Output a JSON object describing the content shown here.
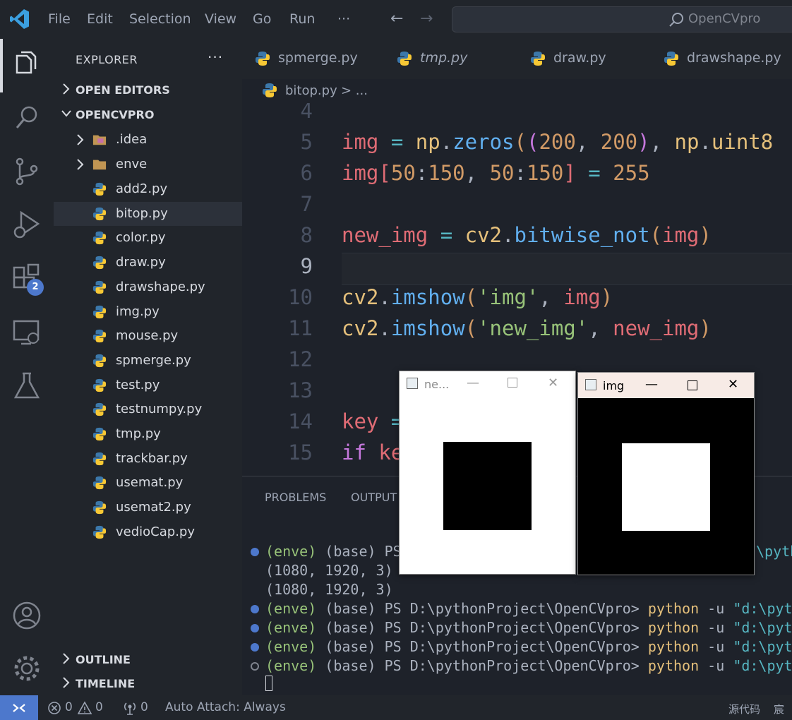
{
  "titlebar": {
    "menu": [
      "File",
      "Edit",
      "Selection",
      "View",
      "Go",
      "Run",
      "···"
    ],
    "search_text": "OpenCVpro"
  },
  "activity_bar": {
    "items": [
      "explorer-icon",
      "search-icon",
      "source-control-icon",
      "run-debug-icon",
      "extensions-icon",
      "remote-explorer-icon",
      "testing-icon"
    ],
    "extensions_badge": "2",
    "bottom": [
      "account-icon",
      "settings-gear-icon"
    ]
  },
  "sidebar": {
    "title": "EXPLORER",
    "more": "···",
    "open_editors": "OPEN EDITORS",
    "project": "OPENCVPRO",
    "folders": [
      ".idea",
      "enve"
    ],
    "files": [
      "add2.py",
      "bitop.py",
      "color.py",
      "draw.py",
      "drawshape.py",
      "img.py",
      "mouse.py",
      "spmerge.py",
      "test.py",
      "testnumpy.py",
      "tmp.py",
      "trackbar.py",
      "usemat.py",
      "usemat2.py",
      "vedioCap.py"
    ],
    "selected_file": "bitop.py",
    "outline": "OUTLINE",
    "timeline": "TIMELINE"
  },
  "tabs": [
    {
      "label": "spmerge.py",
      "italic": false
    },
    {
      "label": "tmp.py",
      "italic": true
    },
    {
      "label": "draw.py",
      "italic": false
    },
    {
      "label": "drawshape.py",
      "italic": false
    }
  ],
  "breadcrumb": {
    "file": "bitop.py",
    "sep": "> ..."
  },
  "editor": {
    "line_numbers": [
      "4",
      "5",
      "6",
      "7",
      "8",
      "9",
      "10",
      "11",
      "12",
      "13",
      "14",
      "15"
    ],
    "current_line": "9"
  },
  "panel": {
    "tabs": [
      "PROBLEMS",
      "OUTPUT"
    ],
    "terminal": {
      "prompt_env": "(enve)",
      "prompt_base": "(base)",
      "prompt_path": "PS D:\\pythonProject\\OpenCVpro>",
      "cmd": "python",
      "flag": "-u",
      "arg": "\"d:\\pyth",
      "partial_path": "\\pyth",
      "outputs": [
        "(1080, 1920, 3)",
        "(1080, 1920, 3)"
      ]
    }
  },
  "statusbar": {
    "errors": "0",
    "warnings": "0",
    "ports": "0",
    "auto_attach": "Auto Attach: Always",
    "right1": "源代码",
    "right2": "宸"
  },
  "cv_windows": [
    {
      "title": "ne...",
      "bg": "#ffffff",
      "square": "#000000"
    },
    {
      "title": "img",
      "bg": "#000000",
      "square": "#ffffff"
    }
  ]
}
